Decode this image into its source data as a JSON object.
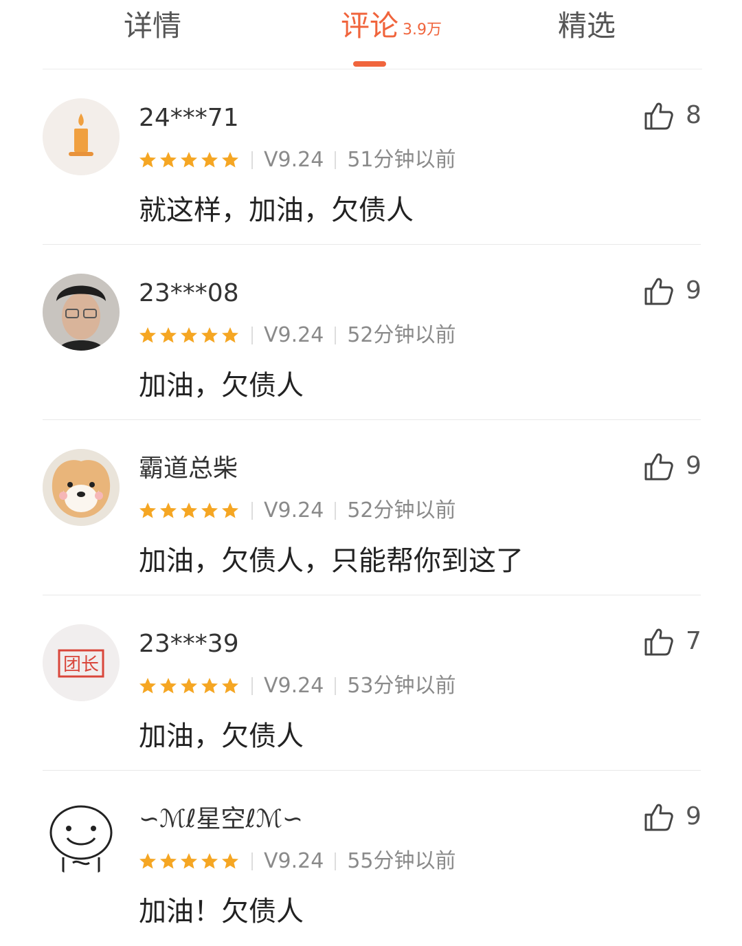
{
  "tabs": [
    {
      "label": "详情"
    },
    {
      "label": "评论",
      "badge": "3.9万",
      "active": true
    },
    {
      "label": "精选"
    }
  ],
  "accent_color": "#f0643c",
  "star_color": "#f5a623",
  "comments": [
    {
      "user": "24***71",
      "avatar_icon": "candle-icon",
      "rating": 5,
      "version": "V9.24",
      "time": "51分钟以前",
      "text": "就这样，加油，欠债人",
      "likes": "8"
    },
    {
      "user": "23***08",
      "avatar_icon": "person-photo",
      "rating": 5,
      "version": "V9.24",
      "time": "52分钟以前",
      "text": "加油，欠债人",
      "likes": "9"
    },
    {
      "user": "霸道总柴",
      "avatar_icon": "shiba-dog",
      "rating": 5,
      "version": "V9.24",
      "time": "52分钟以前",
      "text": "加油，欠债人，只能帮你到这了",
      "likes": "9"
    },
    {
      "user": "23***39",
      "avatar_icon": "tuanzhang-stamp",
      "avatar_text": "团长",
      "rating": 5,
      "version": "V9.24",
      "time": "53分钟以前",
      "text": "加油，欠债人",
      "likes": "7"
    },
    {
      "user": "∽ℳℓ星空ℓℳ∽",
      "avatar_icon": "smiley-face",
      "rating": 5,
      "version": "V9.24",
      "time": "55分钟以前",
      "text": "加油！欠债人",
      "likes": "9"
    }
  ]
}
